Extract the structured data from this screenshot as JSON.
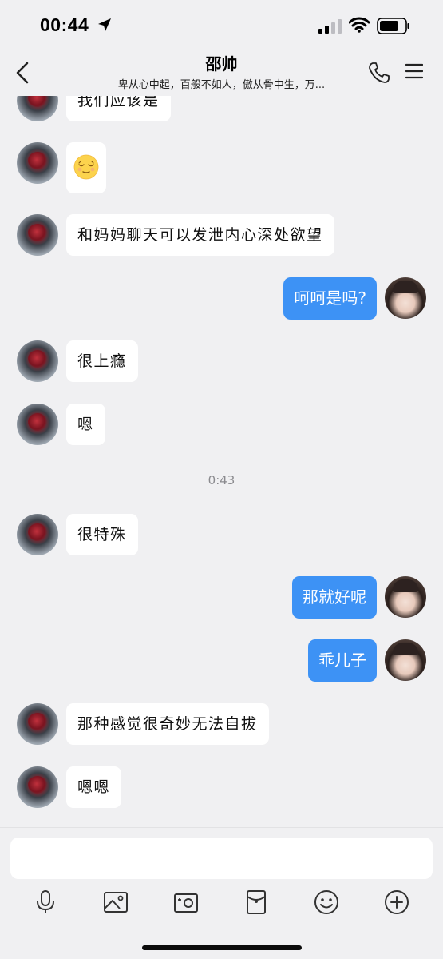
{
  "status_bar": {
    "time": "00:44"
  },
  "header": {
    "title": "邵帅",
    "subtitle": "卑从心中起，百般不如人，傲从骨中生，万..."
  },
  "messages": [
    {
      "side": "in",
      "text": "我们应该是"
    },
    {
      "side": "in",
      "emoji": "relieved-face"
    },
    {
      "side": "in",
      "text": "和妈妈聊天可以发泄内心深处欲望"
    },
    {
      "side": "out",
      "text": "呵呵是吗?"
    },
    {
      "side": "in",
      "text": "很上瘾"
    },
    {
      "side": "in",
      "text": "嗯"
    },
    {
      "side": "in",
      "text": "很特殊"
    },
    {
      "side": "out",
      "text": "那就好呢"
    },
    {
      "side": "out",
      "text": "乖儿子"
    },
    {
      "side": "in",
      "text": "那种感觉很奇妙无法自拔"
    },
    {
      "side": "in",
      "text": "嗯嗯"
    }
  ],
  "timestamp": "0:43",
  "input": {
    "value": "",
    "placeholder": ""
  },
  "toolbar": [
    "microphone-icon",
    "image-icon",
    "camera-icon",
    "red-packet-icon",
    "emoji-icon",
    "plus-icon"
  ],
  "colors": {
    "outgoing_bubble": "#3d92f5",
    "incoming_bubble": "#ffffff",
    "background": "#f0f0f2"
  }
}
